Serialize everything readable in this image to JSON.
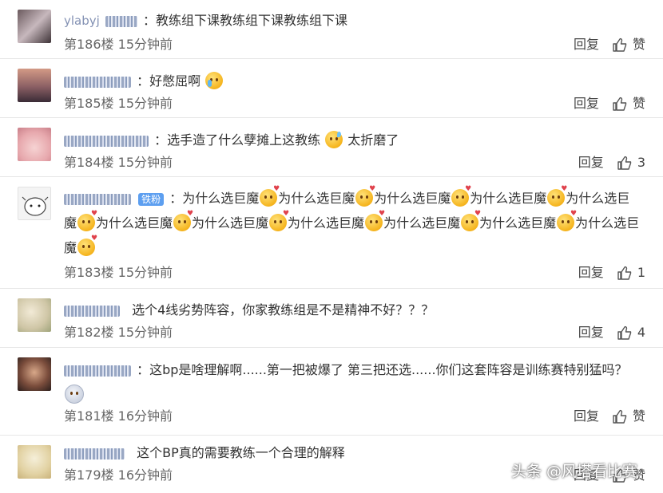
{
  "comments": [
    {
      "user": "ylabyj",
      "badge": "",
      "text_parts": [
        "：教练组下课教练组下课教练组下课"
      ],
      "floor": "第186楼",
      "time": "15分钟前",
      "reply": "回复",
      "likes": "赞"
    },
    {
      "user": "",
      "badge": "",
      "text_parts": [
        "：好憋屈啊"
      ],
      "floor": "第185楼",
      "time": "15分钟前",
      "reply": "回复",
      "likes": "赞"
    },
    {
      "user": "",
      "badge": "",
      "text_parts": [
        "：选手造了什么孽摊上这教练",
        "太折磨了"
      ],
      "floor": "第184楼",
      "time": "15分钟前",
      "reply": "回复",
      "likes": "3"
    },
    {
      "user": "",
      "badge": "铁粉",
      "text_parts": [
        "：为什么选巨魔",
        "为什么选巨魔",
        "为什么选巨魔",
        "为什么选巨魔",
        "为什么选巨魔",
        "为什么选巨魔",
        "为什么选巨魔",
        "为什么选巨魔",
        "为什么选巨魔",
        "为什么选巨魔",
        "为什么选巨魔"
      ],
      "floor": "第183楼",
      "time": "15分钟前",
      "reply": "回复",
      "likes": "1"
    },
    {
      "user": "",
      "badge": "",
      "text_parts": [
        "选个4线劣势阵容，你家教练组是不是精神不好？？？"
      ],
      "floor": "第182楼",
      "time": "15分钟前",
      "reply": "回复",
      "likes": "4"
    },
    {
      "user": "",
      "badge": "",
      "text_parts": [
        "：这bp是啥理解啊......第一把被爆了 第三把还选......你们这套阵容是训练赛特别猛吗？"
      ],
      "floor": "第181楼",
      "time": "16分钟前",
      "reply": "回复",
      "likes": "赞"
    },
    {
      "user": "",
      "badge": "",
      "text_parts": [
        "这个BP真的需要教练一个合理的解释"
      ],
      "floor": "第179楼",
      "time": "16分钟前",
      "reply": "回复",
      "likes": "赞"
    }
  ],
  "watermark": "头条 @风塔看比赛",
  "colors": {
    "username": "#8492b4",
    "badge": "#5d9ff0",
    "text": "#333333",
    "meta": "#666666"
  },
  "icons": {
    "like": "thumbs-up-icon"
  }
}
